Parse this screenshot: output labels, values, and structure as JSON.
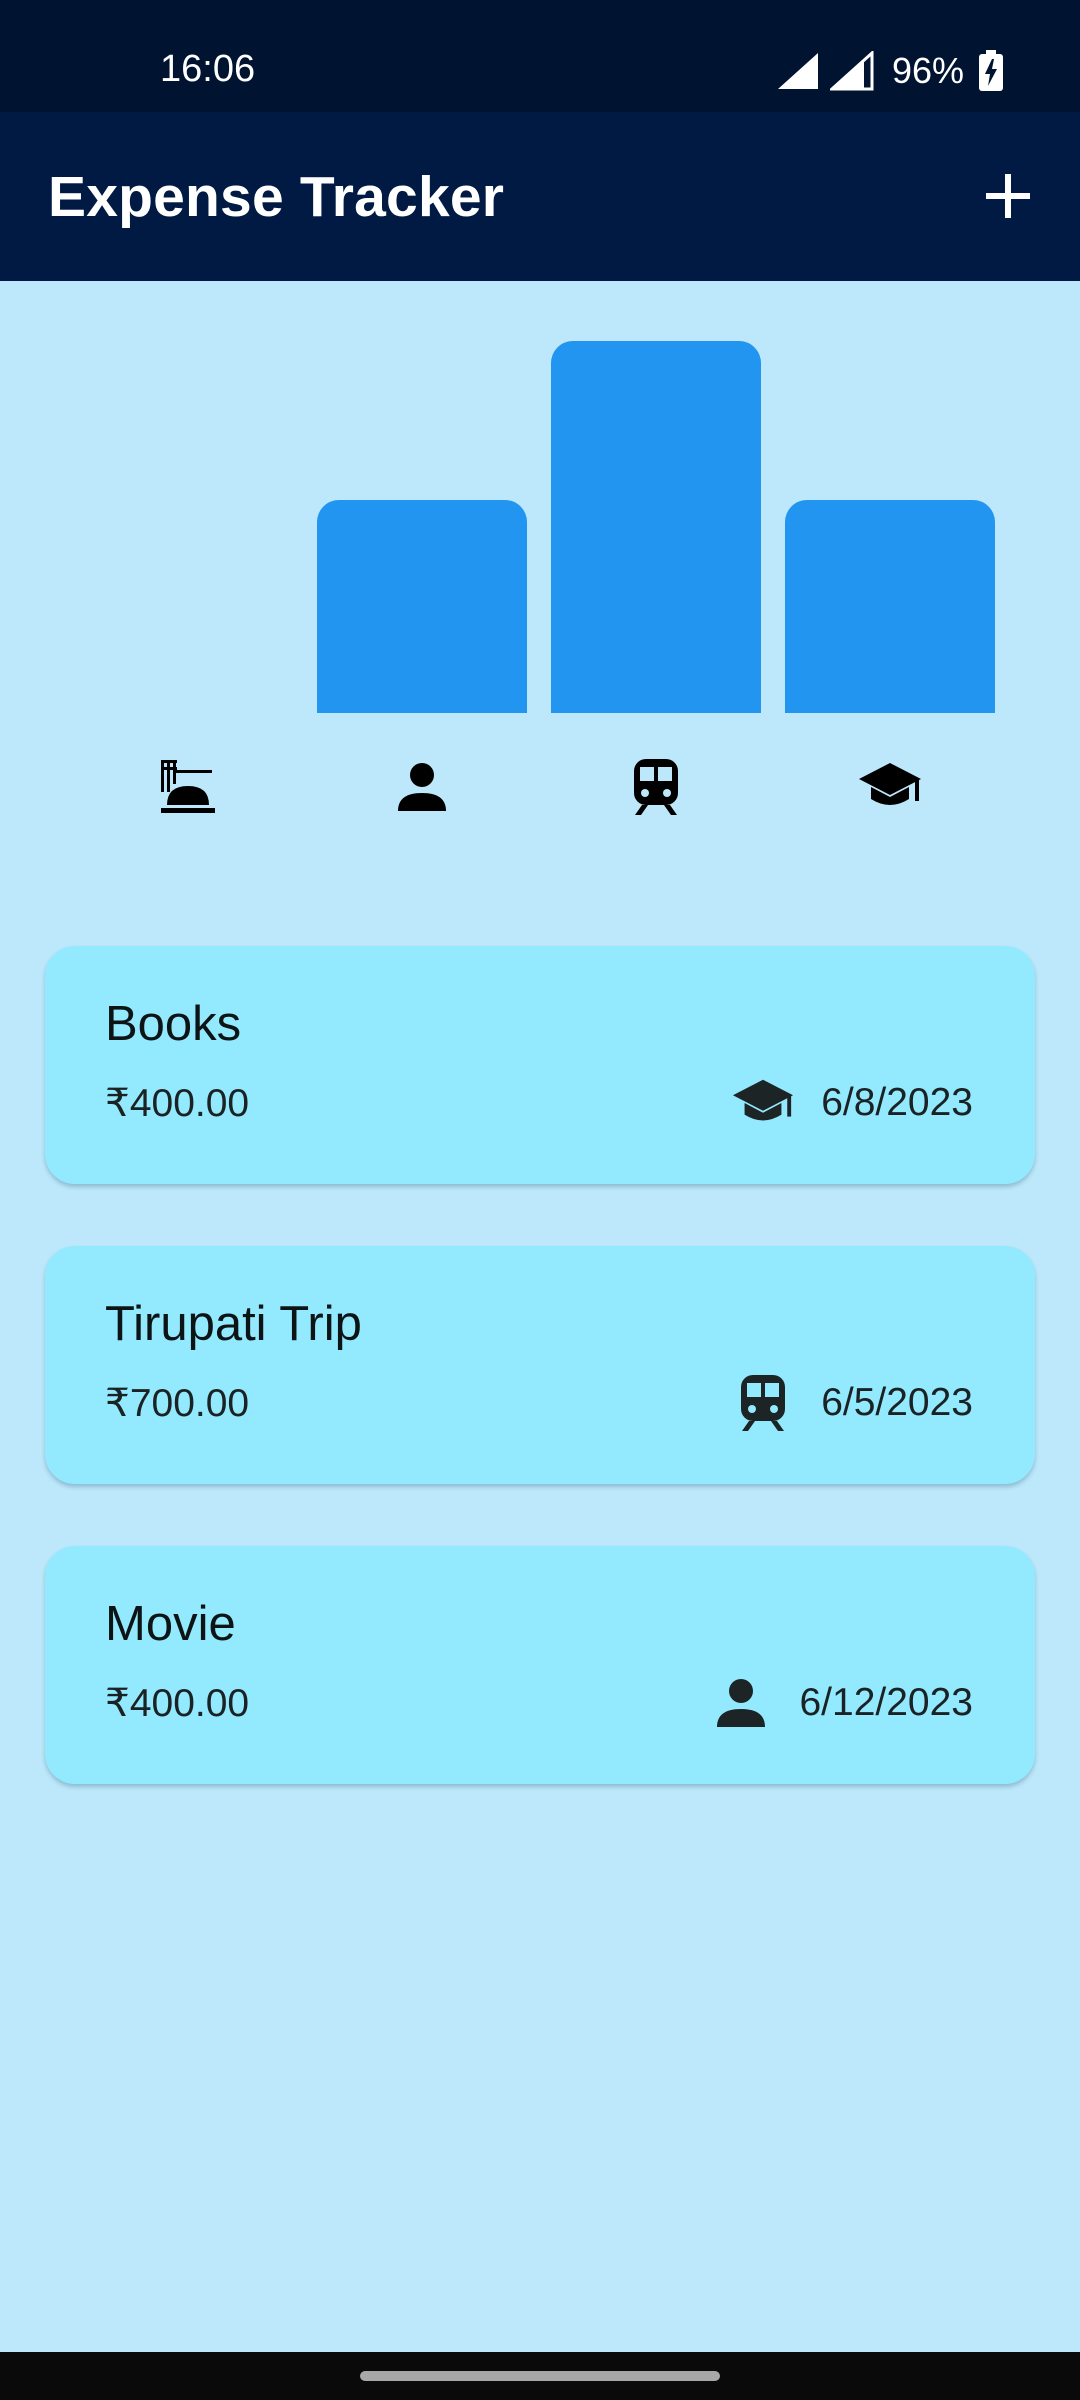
{
  "status_bar": {
    "time": "16:06",
    "battery": "96%"
  },
  "app_bar": {
    "title": "Expense Tracker",
    "add_icon": "plus-icon"
  },
  "chart_data": {
    "type": "bar",
    "categories": [
      "food",
      "leisure",
      "travel",
      "work"
    ],
    "category_icons": [
      "food-icon",
      "person-icon",
      "train-icon",
      "school-icon"
    ],
    "values": [
      0,
      400,
      700,
      400
    ],
    "ylim": [
      0,
      700
    ],
    "color": "#2195f0"
  },
  "expenses": [
    {
      "title": "Books",
      "amount": "₹400.00",
      "date": "6/8/2023",
      "icon": "school-icon"
    },
    {
      "title": "Tirupati Trip",
      "amount": "₹700.00",
      "date": "6/5/2023",
      "icon": "train-icon"
    },
    {
      "title": "Movie",
      "amount": "₹400.00",
      "date": "6/12/2023",
      "icon": "person-icon"
    }
  ],
  "colors": {
    "background": "#bde8fb",
    "status_bar": "#001330",
    "app_bar": "#001a44",
    "card": "#93e9fd",
    "bar": "#2195f0"
  }
}
